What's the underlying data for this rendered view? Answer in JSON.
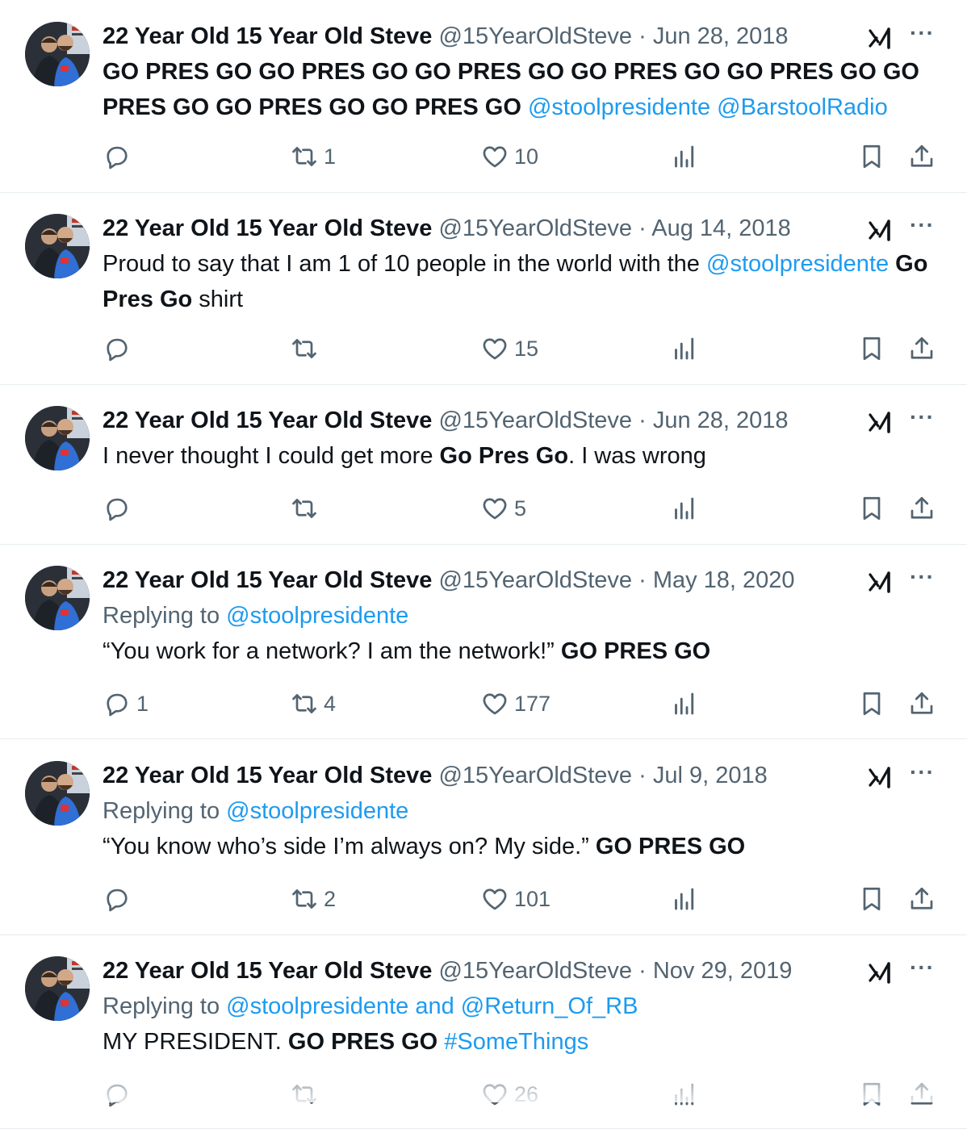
{
  "tweets": [
    {
      "name": "22 Year Old 15 Year Old Steve",
      "meta": "@15YearOldSteve · Jun 28, 2018",
      "replying": null,
      "segments": [
        {
          "t": "GO PRES GO GO PRES GO GO PRES GO GO PRES GO GO PRES GO GO PRES GO GO PRES GO GO PRES GO ",
          "s": "b"
        },
        {
          "t": "@stoolpresidente @BarstoolRadio",
          "s": "link"
        }
      ],
      "counts": {
        "reply": "",
        "retweet": "1",
        "like": "10"
      }
    },
    {
      "name": "22 Year Old 15 Year Old Steve",
      "meta": "@15YearOldSteve · Aug 14, 2018",
      "replying": null,
      "segments": [
        {
          "t": "Proud to say that I am 1 of 10 people in the world with the ",
          "s": ""
        },
        {
          "t": "@stoolpresidente",
          "s": "link"
        },
        {
          "t": " Go Pres Go",
          "s": "b"
        },
        {
          "t": " shirt",
          "s": ""
        }
      ],
      "counts": {
        "reply": "",
        "retweet": "",
        "like": "15"
      }
    },
    {
      "name": "22 Year Old 15 Year Old Steve",
      "meta": "@15YearOldSteve · Jun 28, 2018",
      "replying": null,
      "segments": [
        {
          "t": "I never thought I could get more ",
          "s": ""
        },
        {
          "t": "Go Pres Go",
          "s": "b"
        },
        {
          "t": ". I was wrong",
          "s": ""
        }
      ],
      "counts": {
        "reply": "",
        "retweet": "",
        "like": "5"
      }
    },
    {
      "name": "22 Year Old 15 Year Old Steve",
      "meta": "@15YearOldSteve · May 18, 2020",
      "replying": {
        "prefix": "Replying to ",
        "users": "@stoolpresidente"
      },
      "segments": [
        {
          "t": "“You work for a network? I am the network!” ",
          "s": ""
        },
        {
          "t": "GO PRES GO",
          "s": "b"
        }
      ],
      "counts": {
        "reply": "1",
        "retweet": "4",
        "like": "177"
      }
    },
    {
      "name": "22 Year Old 15 Year Old Steve",
      "meta": "@15YearOldSteve · Jul 9, 2018",
      "replying": {
        "prefix": "Replying to ",
        "users": "@stoolpresidente"
      },
      "segments": [
        {
          "t": "“You know who’s side I’m always on? My side.” ",
          "s": ""
        },
        {
          "t": "GO PRES GO",
          "s": "b"
        }
      ],
      "counts": {
        "reply": "",
        "retweet": "2",
        "like": "101"
      }
    },
    {
      "name": "22 Year Old 15 Year Old Steve",
      "meta": "@15YearOldSteve · Nov 29, 2019",
      "replying": {
        "prefix": "Replying to ",
        "users": "@stoolpresidente and @Return_Of_RB"
      },
      "segments": [
        {
          "t": "MY PRESIDENT. ",
          "s": ""
        },
        {
          "t": "GO PRES GO",
          "s": "b"
        },
        {
          "t": " #SomeThings",
          "s": "link"
        }
      ],
      "counts": {
        "reply": "",
        "retweet": "",
        "like": "26"
      }
    }
  ],
  "colors": {
    "text": "#0f1419",
    "muted": "#536471",
    "link": "#1d9bf0",
    "divider": "#e6ecf0"
  },
  "icons": {
    "reply": "reply-icon",
    "retweet": "retweet-icon",
    "like": "heart-icon",
    "views": "views-icon",
    "bookmark": "bookmark-icon",
    "share": "share-icon",
    "grok": "grok-icon",
    "more": "more-icon"
  }
}
